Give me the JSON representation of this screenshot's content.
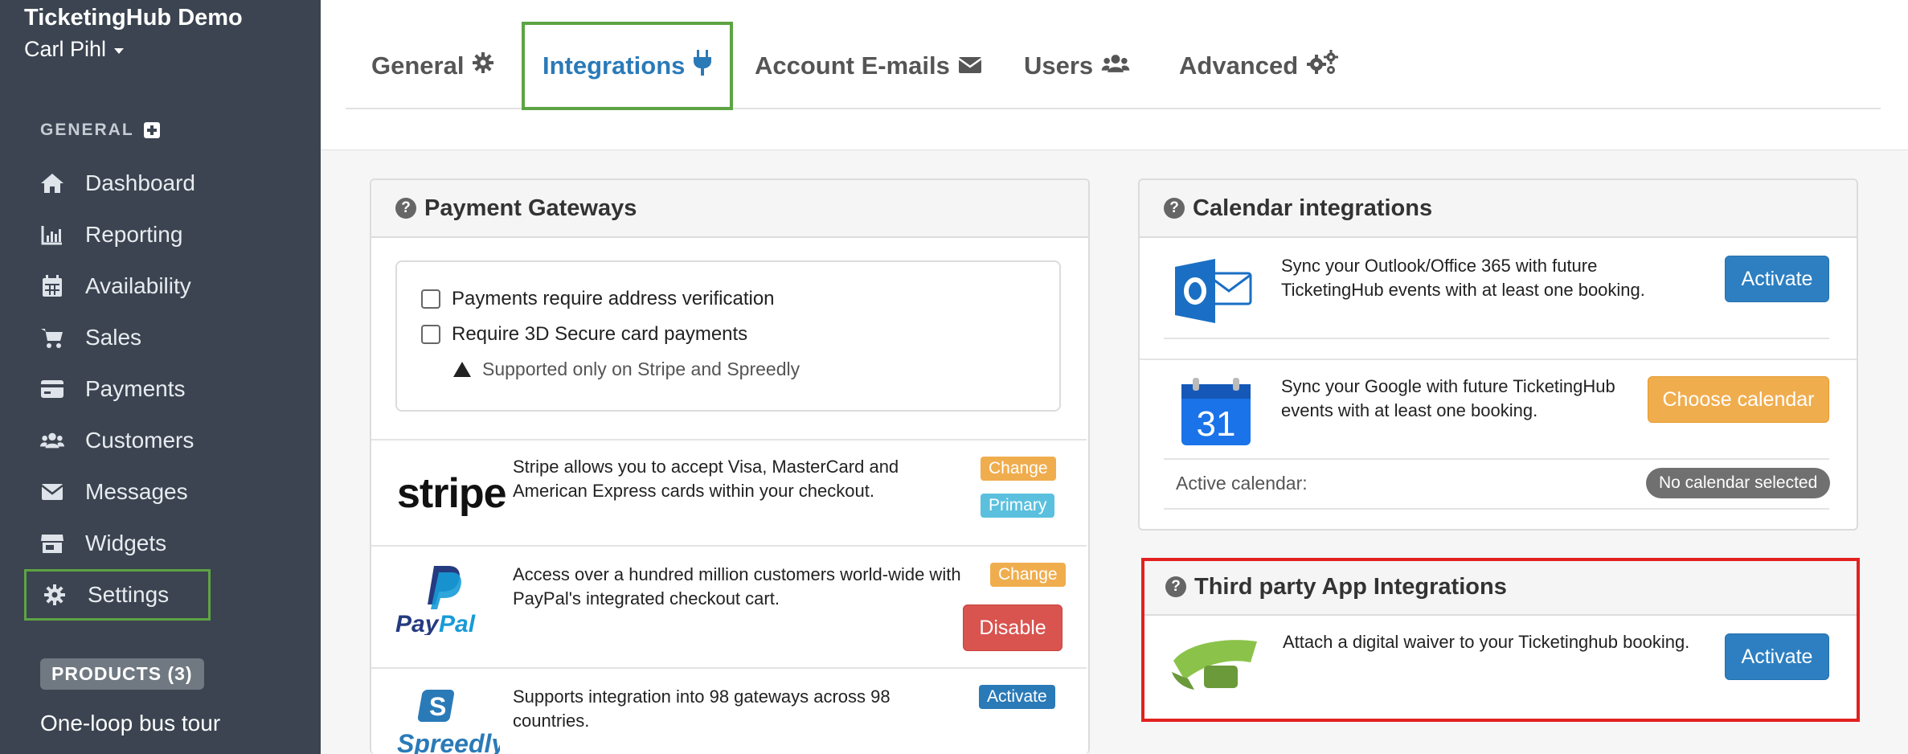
{
  "app": {
    "name": "TicketingHub Demo",
    "user": "Carl Pihl"
  },
  "sidebar": {
    "section_title": "GENERAL",
    "items": [
      {
        "label": "Dashboard",
        "icon": "home-icon"
      },
      {
        "label": "Reporting",
        "icon": "bar-chart-icon"
      },
      {
        "label": "Availability",
        "icon": "calendar-icon"
      },
      {
        "label": "Sales",
        "icon": "cart-icon"
      },
      {
        "label": "Payments",
        "icon": "credit-card-icon"
      },
      {
        "label": "Customers",
        "icon": "users-icon"
      },
      {
        "label": "Messages",
        "icon": "envelope-icon"
      },
      {
        "label": "Widgets",
        "icon": "store-icon"
      },
      {
        "label": "Settings",
        "icon": "gear-icon",
        "active": true
      }
    ],
    "products_badge": "PRODUCTS (3)",
    "product_item": "One-loop bus tour"
  },
  "tabs": [
    {
      "label": "General",
      "icon": "gear-icon"
    },
    {
      "label": "Integrations",
      "icon": "plug-icon",
      "active": true
    },
    {
      "label": "Account E-mails",
      "icon": "envelope-icon"
    },
    {
      "label": "Users",
      "icon": "users-icon"
    },
    {
      "label": "Advanced",
      "icon": "gears-icon"
    }
  ],
  "payment": {
    "title": "Payment Gateways",
    "check_address": "Payments require address verification",
    "check_3d": "Require 3D Secure card payments",
    "note": "Supported only on Stripe and Spreedly",
    "gateways": [
      {
        "name": "stripe",
        "desc": "Stripe allows you to accept Visa, MasterCard and American Express cards within your checkout.",
        "change": "Change",
        "primary": "Primary"
      },
      {
        "name": "PayPal",
        "desc": "Access over a hundred million customers world-wide with PayPal's integrated checkout cart.",
        "change": "Change",
        "disable": "Disable"
      },
      {
        "name": "Spreedly",
        "desc": "Supports integration into 98 gateways across 98 countries.",
        "activate": "Activate"
      }
    ]
  },
  "calendar": {
    "title": "Calendar integrations",
    "outlook_desc": "Sync your Outlook/Office 365 with future TicketingHub events with at least one booking.",
    "outlook_btn": "Activate",
    "google_desc": "Sync your Google with future TicketingHub events with at least one booking.",
    "google_btn": "Choose calendar",
    "google_day": "31",
    "active_label": "Active calendar:",
    "active_value": "No calendar selected"
  },
  "third_party": {
    "title": "Third party App Integrations",
    "desc": "Attach a digital waiver to your Ticketinghub booking.",
    "btn": "Activate"
  },
  "colors": {
    "sidebar": "#3b4450",
    "accent": "#2a7ab8",
    "highlight_green": "#5da444",
    "highlight_red": "#e32020"
  }
}
